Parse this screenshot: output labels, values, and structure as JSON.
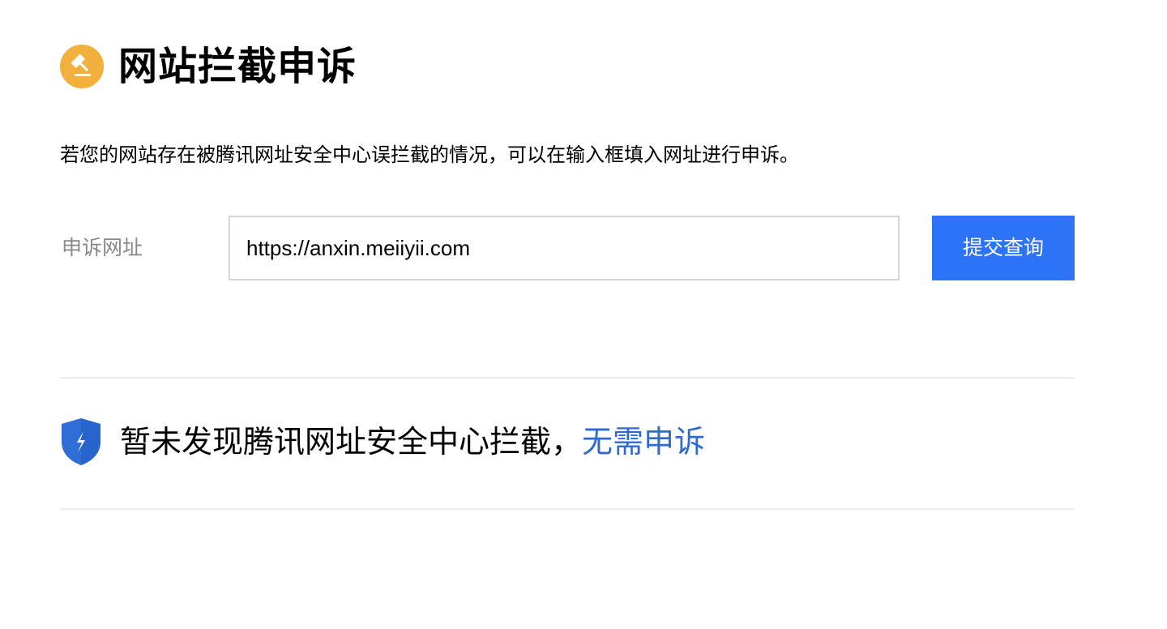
{
  "header": {
    "title": "网站拦截申诉",
    "icon": "gavel-icon",
    "icon_color": "#f2b03c"
  },
  "intro": {
    "text": "若您的网站存在被腾讯网址安全中心误拦截的情况，可以在输入框填入网址进行申诉。"
  },
  "form": {
    "label": "申诉网址",
    "url_value": "https://anxin.meiiyii.com",
    "submit_label": "提交查询",
    "submit_color": "#2d73f5"
  },
  "result": {
    "icon": "shield-icon",
    "icon_color": "#2f6ed6",
    "message": "暂未发现腾讯网址安全中心拦截，",
    "link_text": "无需申诉",
    "link_color": "#2e6ad1"
  }
}
